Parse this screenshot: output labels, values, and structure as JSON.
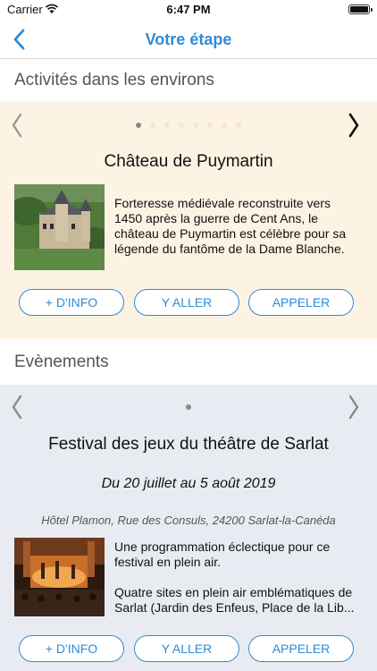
{
  "status_bar": {
    "carrier": "Carrier",
    "time": "6:47 PM"
  },
  "nav": {
    "title": "Votre étape",
    "back_icon": "chevron-left-icon"
  },
  "activities": {
    "header": "Activités dans les environs",
    "total_pages": 8,
    "current_page": 1,
    "item": {
      "title": "Château de Puymartin",
      "description_lines": [
        "Forteresse médiévale reconstruite vers",
        "1450 après la guerre de Cent Ans, le",
        "château de Puymartin est célèbre pour sa",
        "légende du fantôme de la Dame Blanche."
      ]
    },
    "buttons": {
      "info": "+ D'INFO",
      "go": "Y ALLER",
      "call": "APPELER"
    }
  },
  "events": {
    "header": "Evènements",
    "total_pages": 1,
    "current_page": 1,
    "item": {
      "title": "Festival des jeux du théâtre de Sarlat",
      "date": "Du 20 juillet au 5 août 2019",
      "place": "Hôtel Plamon, Rue des Consuls, 24200 Sarlat-la-Canéda",
      "description_lines": [
        "Une programmation éclectique pour ce",
        "festival en plein air.",
        "",
        "Quatre sites en plein air emblématiques de",
        "Sarlat (Jardin des Enfeus, Place de la Lib..."
      ]
    },
    "buttons": {
      "info": "+ D'INFO",
      "go": "Y ALLER",
      "call": "APPELER"
    }
  },
  "colors": {
    "accent": "#2e8bd6",
    "activity_bg": "#fdf3e3",
    "event_bg": "#e8ecf2"
  }
}
